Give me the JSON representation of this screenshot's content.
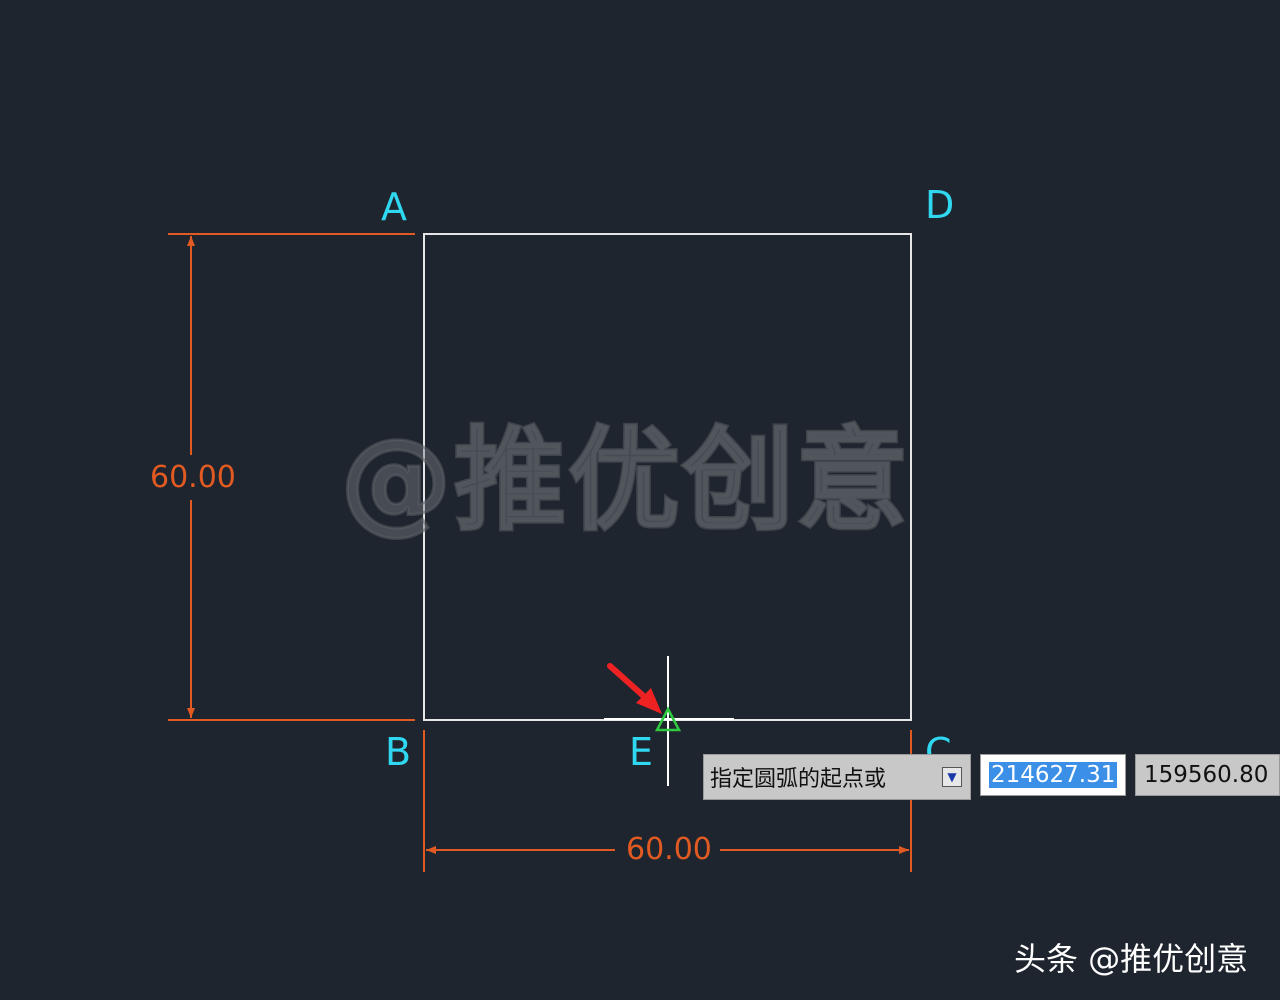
{
  "drawing": {
    "points": {
      "A": "A",
      "B": "B",
      "C": "C",
      "D": "D",
      "E": "E"
    },
    "dim_vertical": "60.00",
    "dim_horizontal": "60.00",
    "colors": {
      "background": "#1f252e",
      "geometry": "#e6e6e6",
      "dimension": "#e05a22",
      "point_label": "#2fd8f0",
      "snap_marker": "#2ecc40",
      "pointer_arrow": "#ee2222"
    }
  },
  "watermark": "@推优创意",
  "command_prompt": {
    "text": "指定圆弧的起点或",
    "options_icon": "down-arrow-options-icon",
    "x_value": "214627.31",
    "y_value": "159560.80"
  },
  "footer": {
    "credit": "头条 @推优创意"
  }
}
